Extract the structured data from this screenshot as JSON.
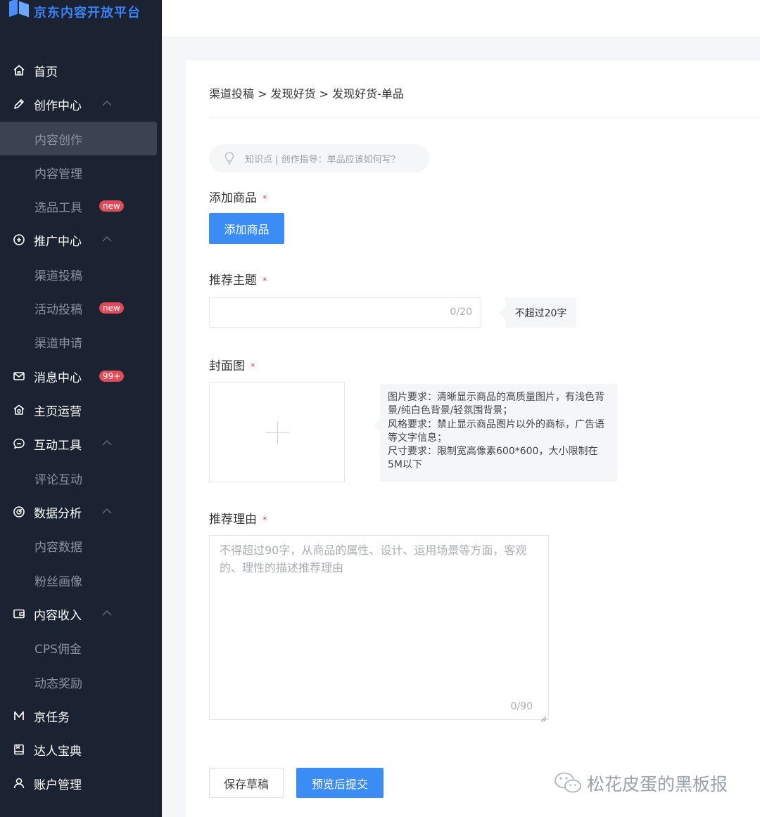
{
  "app": {
    "logo_text": "京东内容开放平台"
  },
  "sidebar": {
    "items": [
      {
        "label": "首页",
        "icon": "home-icon"
      },
      {
        "label": "创作中心",
        "icon": "pen-icon"
      },
      {
        "label": "内容创作"
      },
      {
        "label": "内容管理"
      },
      {
        "label": "选品工具",
        "badge": "new"
      },
      {
        "label": "推广中心",
        "icon": "promote-icon"
      },
      {
        "label": "渠道投稿"
      },
      {
        "label": "活动投稿",
        "badge": "new"
      },
      {
        "label": "渠道申请"
      },
      {
        "label": "消息中心",
        "icon": "mail-icon",
        "badge": "99+"
      },
      {
        "label": "主页运营",
        "icon": "home-operate-icon"
      },
      {
        "label": "互动工具",
        "icon": "chat-icon"
      },
      {
        "label": "评论互动"
      },
      {
        "label": "数据分析",
        "icon": "analytics-icon"
      },
      {
        "label": "内容数据"
      },
      {
        "label": "粉丝画像"
      },
      {
        "label": "内容收入",
        "icon": "wallet-icon"
      },
      {
        "label": "CPS佣金"
      },
      {
        "label": "动态奖励"
      },
      {
        "label": "京任务",
        "icon": "m-icon"
      },
      {
        "label": "达人宝典",
        "icon": "book-icon"
      },
      {
        "label": "账户管理",
        "icon": "user-icon"
      }
    ]
  },
  "breadcrumb": "渠道投稿 > 发现好货 > 发现好货-单品",
  "tip": "知识点 | 创作指导：单品应该如何写？",
  "form": {
    "required_mark": "*",
    "add_product": {
      "label": "添加商品",
      "button": "添加商品"
    },
    "topic": {
      "label": "推荐主题",
      "counter": "0/20",
      "hint": "不超过20字"
    },
    "cover": {
      "label": "封面图",
      "requirements": [
        "图片要求：清晰显示商品的高质量图片，有浅色背景/纯白色背景/轻氛围背景；",
        "风格要求：禁止显示商品图片以外的商标，广告语等文字信息；",
        "尺寸要求：限制宽高像素600*600，大小限制在5M以下"
      ]
    },
    "reason": {
      "label": "推荐理由",
      "placeholder": "不得超过90字，从商品的属性、设计、运用场景等方面，客观的、理性的描述推荐理由",
      "counter": "0/90"
    }
  },
  "actions": {
    "save_draft": "保存草稿",
    "preview_submit": "预览后提交"
  },
  "watermark": "松花皮蛋的黑板报",
  "colors": {
    "sidebar_bg": "#1b2231",
    "primary": "#3b8cf5",
    "badge": "#e24a58"
  }
}
